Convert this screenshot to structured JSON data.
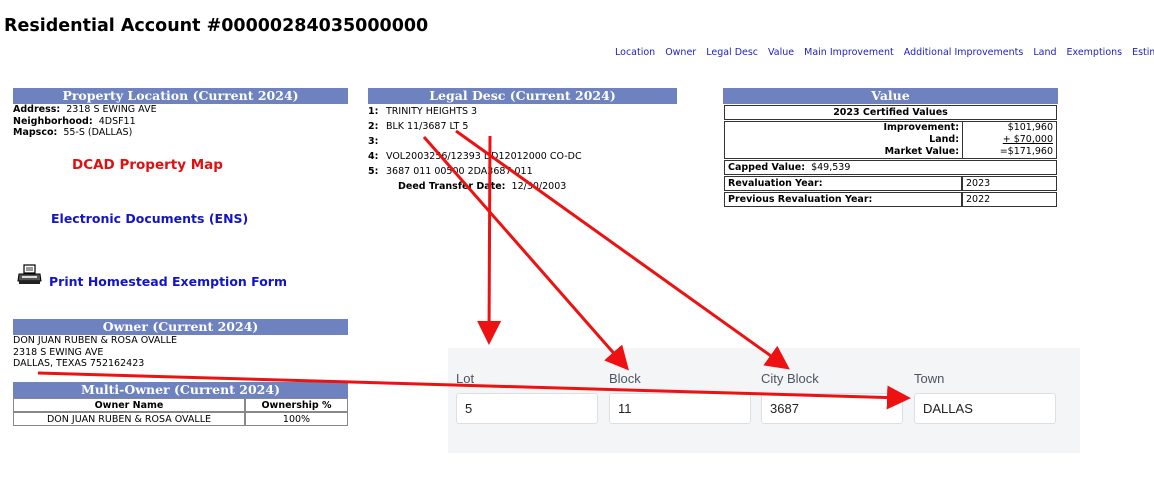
{
  "page_title": "Residential Account #00000284035000000",
  "nav": {
    "links": [
      "Location",
      "Owner",
      "Legal Desc",
      "Value",
      "Main Improvement",
      "Additional Improvements",
      "Land",
      "Exemptions",
      "Estimated T"
    ]
  },
  "property_location": {
    "header": "Property Location (Current 2024)",
    "address_label": "Address:",
    "address_value": "2318 S EWING AVE",
    "neighborhood_label": "Neighborhood:",
    "neighborhood_value": "4DSF11",
    "mapsco_label": "Mapsco:",
    "mapsco_value": "55-S (DALLAS)"
  },
  "links": {
    "dcad_map": "DCAD Property Map",
    "electronic_docs": "Electronic Documents (ENS)",
    "print_homestead": "Print Homestead Exemption Form"
  },
  "owner": {
    "header": "Owner (Current 2024)",
    "line1": "DON JUAN RUBEN & ROSA OVALLE",
    "line2": "2318 S EWING AVE",
    "line3": "DALLAS, TEXAS 752162423"
  },
  "multi_owner": {
    "header": "Multi-Owner (Current 2024)",
    "columns": [
      "Owner Name",
      "Ownership %"
    ],
    "rows": [
      [
        "DON JUAN RUBEN & ROSA OVALLE",
        "100%"
      ]
    ]
  },
  "legal_desc": {
    "header": "Legal Desc (Current 2024)",
    "lines": [
      {
        "num": "1:",
        "text": "TRINITY HEIGHTS 3"
      },
      {
        "num": "2:",
        "text": "BLK 11/3687 LT 5"
      },
      {
        "num": "3:",
        "text": ""
      },
      {
        "num": "4:",
        "text": "VOL2003256/12393 DD12012000 CO-DC"
      },
      {
        "num": "5:",
        "text": "3687 011 00500 2DA3687 011"
      }
    ],
    "deed_label": "Deed Transfer Date:",
    "deed_value": "12/30/2003"
  },
  "value": {
    "header": "Value",
    "certified_title": "2023 Certified Values",
    "improvement_label": "Improvement:",
    "improvement_value": "$101,960",
    "land_label": "Land:",
    "land_value": "+ $70,000",
    "market_label": "Market Value:",
    "market_value": "=$171,960",
    "capped_label": "Capped Value:",
    "capped_value": "$49,539",
    "revaluation_label": "Revaluation Year:",
    "revaluation_value": "2023",
    "prev_revaluation_label": "Previous Revaluation Year:",
    "prev_revaluation_value": "2022"
  },
  "form": {
    "fields": [
      {
        "label": "Lot",
        "value": "5"
      },
      {
        "label": "Block",
        "value": "11"
      },
      {
        "label": "City Block",
        "value": "3687"
      },
      {
        "label": "Town",
        "value": "DALLAS"
      }
    ]
  },
  "colors": {
    "section_header": "#6e82c0",
    "arrow": "#ee1111",
    "link_blue": "#1313c8",
    "link_red": "#e01010"
  }
}
